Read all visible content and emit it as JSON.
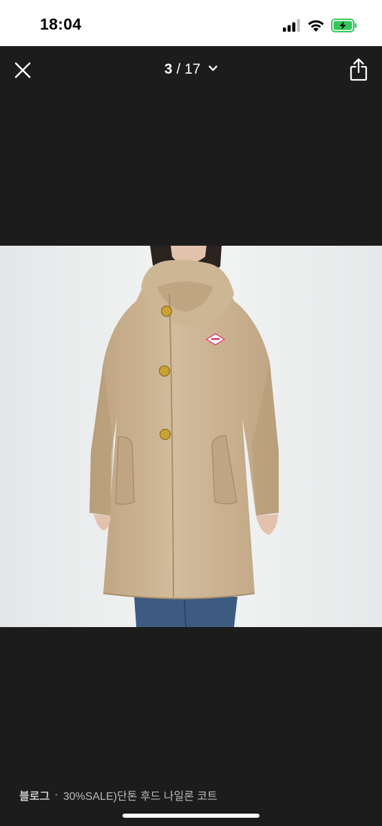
{
  "status_bar": {
    "time": "18:04",
    "icons": [
      "cellular-signal-icon",
      "wifi-icon",
      "battery-charging-icon"
    ]
  },
  "nav": {
    "current": "3",
    "separator": " / ",
    "total": "17",
    "icons": [
      "close-icon",
      "chevron-down-icon",
      "share-icon"
    ]
  },
  "photo": {
    "subject": "beige hooded nylon coat",
    "badge_color": "#e24b7a",
    "coat_color": "#cbb393"
  },
  "caption": {
    "shop": "블로그",
    "separator": "•",
    "title": "30%SALE)단톤 후드 나일론 코트"
  },
  "colors": {
    "background": "#1c1c1c",
    "status_bar": "#ffffff",
    "text_light": "#ffffff",
    "caption_text": "#b9b9b9",
    "battery_green": "#34c759"
  }
}
